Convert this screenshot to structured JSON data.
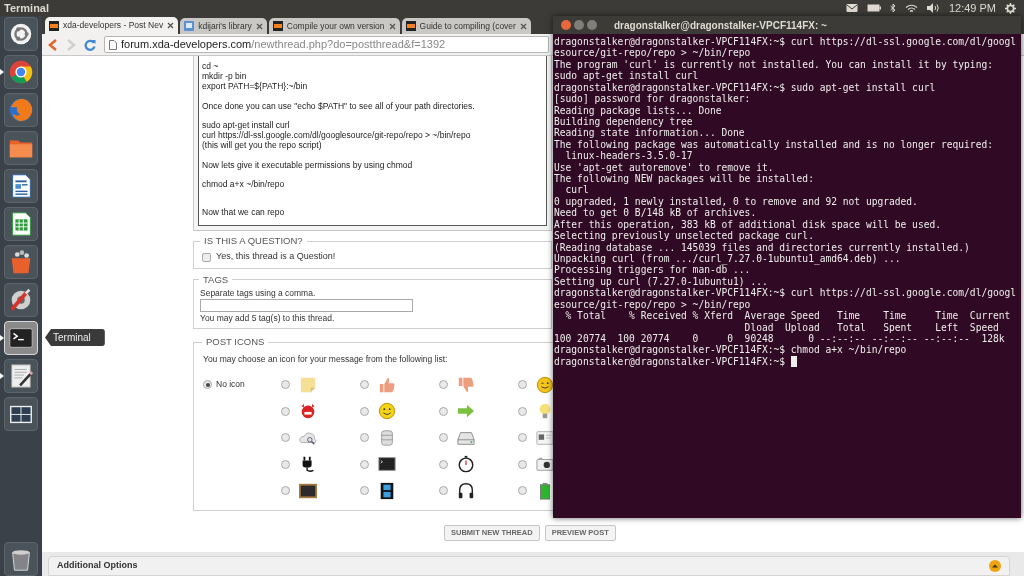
{
  "top_panel": {
    "app_title": "Terminal",
    "clock": "12:49 PM"
  },
  "launcher": {
    "items": [
      {
        "running": false,
        "focused": false
      },
      {
        "running": true,
        "focused": false
      },
      {
        "running": false,
        "focused": false
      },
      {
        "running": false,
        "focused": false
      },
      {
        "running": false,
        "focused": false
      },
      {
        "running": false,
        "focused": false
      },
      {
        "running": false,
        "focused": false
      },
      {
        "running": false,
        "focused": false
      },
      {
        "running": true,
        "focused": true
      },
      {
        "running": true,
        "focused": false
      },
      {
        "running": false,
        "focused": false
      },
      {
        "running": false,
        "focused": false
      }
    ],
    "tooltip": "Terminal"
  },
  "browser": {
    "tabs": [
      {
        "title": "xda-developers - Post Nev",
        "selected": true
      },
      {
        "title": "kdijari's library",
        "selected": false
      },
      {
        "title": "Compile your own version",
        "selected": false
      },
      {
        "title": "Guide to compiling (cover",
        "selected": false
      }
    ],
    "address": {
      "host": "forum.xda-developers.com",
      "path": "/newthread.php?do=postthread&f=1392"
    },
    "editor_paragraphs": [
      [
        "cd ~",
        "mkdir -p bin",
        "export PATH=${PATH}:~/bin"
      ],
      [
        "Once done you can use \"echo $PATH\" to see all of your path directories."
      ],
      [
        "sudo apt-get install curl",
        "curl https://dl-ssl.google.com/dl/googlesource/git-repo/repo > ~/bin/repo",
        "(this will get you the repo script)"
      ],
      [
        "Now lets give it executable permissions by using chmod"
      ],
      [
        "chmod a+x ~/bin/repo"
      ],
      [
        "Now that we can repo"
      ]
    ],
    "question": {
      "title": "IS THIS A QUESTION?",
      "label": "Yes, this thread is a Question!",
      "checked": false
    },
    "tags": {
      "title": "TAGS",
      "hint": "Separate tags using a comma.",
      "note": "You may add 5 tag(s) to this thread."
    },
    "post_icons": {
      "title": "POST ICONS",
      "hint": "You may choose an icon for your message from the following list:",
      "none_label": "No icon",
      "none_selected": true,
      "options": [
        {
          "selected": false
        },
        {
          "selected": false
        },
        {
          "selected": false
        },
        {
          "selected": false
        },
        {
          "selected": false
        },
        {
          "selected": false
        },
        {
          "selected": false
        },
        {
          "selected": false
        },
        {
          "selected": false
        },
        {
          "selected": false
        },
        {
          "selected": false
        },
        {
          "selected": false
        },
        {
          "selected": false
        },
        {
          "selected": false
        },
        {
          "selected": false
        },
        {
          "selected": false
        },
        {
          "selected": false
        },
        {
          "selected": false
        },
        {
          "selected": false
        },
        {
          "selected": false
        }
      ]
    },
    "buttons": [
      "SUBMIT NEW THREAD",
      "PREVIEW POST"
    ],
    "additional_options": "Additional Options"
  },
  "terminal": {
    "title": "dragonstalker@dragonstalker-VPCF114FX: ~",
    "lines": [
      "dragonstalker@dragonstalker-VPCF114FX:~$ curl https://dl-ssl.google.com/dl/googl",
      "esource/git-repo/repo > ~/bin/repo",
      "The program 'curl' is currently not installed. You can install it by typing:",
      "sudo apt-get install curl",
      "dragonstalker@dragonstalker-VPCF114FX:~$ sudo apt-get install curl",
      "[sudo] password for dragonstalker:",
      "Reading package lists... Done",
      "Building dependency tree",
      "Reading state information... Done",
      "The following package was automatically installed and is no longer required:",
      "  linux-headers-3.5.0-17",
      "Use 'apt-get autoremove' to remove it.",
      "The following NEW packages will be installed:",
      "  curl",
      "0 upgraded, 1 newly installed, 0 to remove and 92 not upgraded.",
      "Need to get 0 B/148 kB of archives.",
      "After this operation, 383 kB of additional disk space will be used.",
      "Selecting previously unselected package curl.",
      "(Reading database ... 145039 files and directories currently installed.)",
      "Unpacking curl (from .../curl_7.27.0-1ubuntu1_amd64.deb) ...",
      "Processing triggers for man-db ...",
      "Setting up curl (7.27.0-1ubuntu1) ...",
      "dragonstalker@dragonstalker-VPCF114FX:~$ curl https://dl-ssl.google.com/dl/googl",
      "esource/git-repo/repo > ~/bin/repo",
      "  % Total    % Received % Xferd  Average Speed   Time    Time     Time  Current",
      "                                 Dload  Upload   Total   Spent    Left  Speed",
      "100 20774  100 20774    0     0  90248      0 --:--:-- --:--:-- --:--:--  128k",
      "dragonstalker@dragonstalker-VPCF114FX:~$ chmod a+x ~/bin/repo",
      "dragonstalker@dragonstalker-VPCF114FX:~$"
    ]
  }
}
